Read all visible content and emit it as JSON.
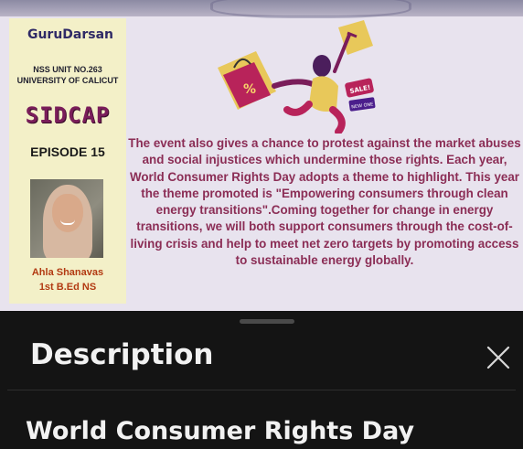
{
  "poster": {
    "brand": "GuruDarsan",
    "nss_line1": "NSS UNIT NO.263",
    "nss_line2": "UNIVERSITY OF CALICUT",
    "series": "SIDCAP",
    "episode": "EPISODE 15",
    "person_name": "Ahla Shanavas",
    "person_role": "1st B.Ed NS",
    "body_text": "The event also gives a chance to protest against the market abuses and social injustices which undermine those rights. Each year, World Consumer Rights Day adopts a theme to highlight. This year the theme promoted is \"Empowering consumers through clean energy transitions\".Coming together for change in energy transitions, we will both support consumers through the cost-of-living crisis and help to meet net zero targets by promoting access to sustainable energy globally.",
    "bag_symbol": "%",
    "sale_tag": "SALE!",
    "small_tag": "NEW ONE",
    "colors": {
      "panel": "#f3f0c8",
      "text": "#8b2d55",
      "series": "#7a1d5a",
      "accent": "#b23a12"
    }
  },
  "sheet": {
    "title": "Description",
    "close_icon": "close-icon",
    "heading": "World Consumer Rights Day"
  }
}
